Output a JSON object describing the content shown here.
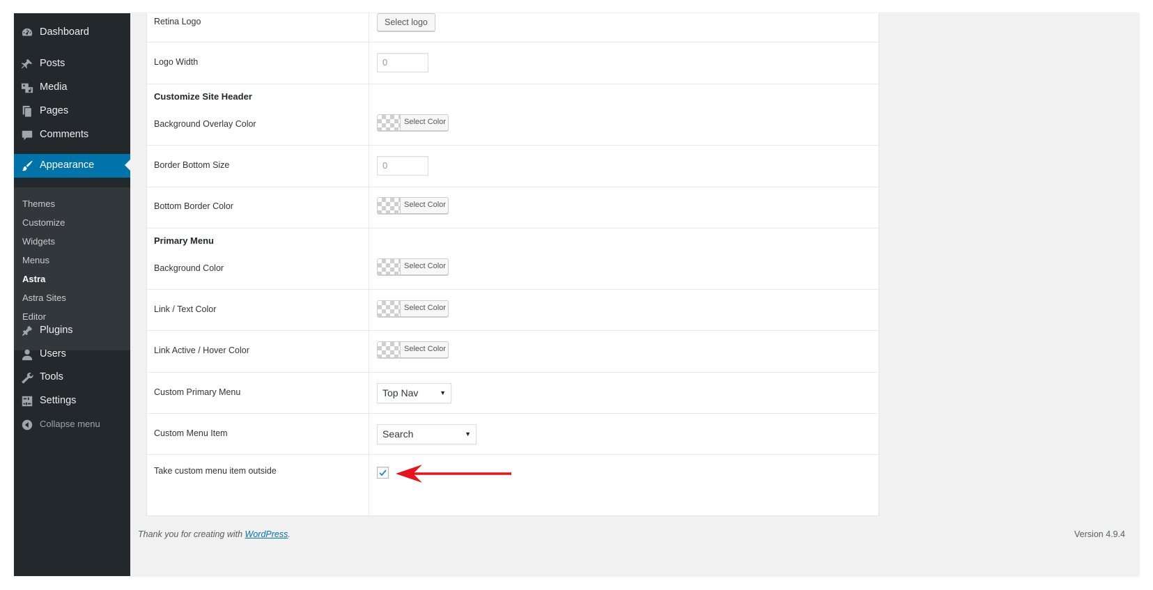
{
  "sidebar": {
    "items": [
      {
        "label": "Dashboard",
        "icon": "dashboard-icon"
      },
      {
        "label": "Posts",
        "icon": "pin-icon"
      },
      {
        "label": "Media",
        "icon": "media-icon"
      },
      {
        "label": "Pages",
        "icon": "pages-icon"
      },
      {
        "label": "Comments",
        "icon": "comment-icon"
      },
      {
        "label": "Appearance",
        "icon": "brush-icon"
      },
      {
        "label": "Plugins",
        "icon": "plugin-icon"
      },
      {
        "label": "Users",
        "icon": "user-icon"
      },
      {
        "label": "Tools",
        "icon": "wrench-icon"
      },
      {
        "label": "Settings",
        "icon": "settings-icon"
      }
    ],
    "submenu": [
      "Themes",
      "Customize",
      "Widgets",
      "Menus",
      "Astra",
      "Astra Sites",
      "Editor"
    ],
    "collapse_label": "Collapse menu",
    "current_item": "Appearance",
    "current_subitem": "Astra"
  },
  "form": {
    "retina_logo": {
      "label": "Retina Logo",
      "button": "Select logo"
    },
    "logo_width": {
      "label": "Logo Width",
      "value": "0"
    },
    "site_header": {
      "title": "Customize Site Header",
      "bg_overlay_label": "Background Overlay Color",
      "border_bottom_size_label": "Border Bottom Size",
      "border_bottom_size_value": "0",
      "bottom_border_color_label": "Bottom Border Color"
    },
    "primary_menu": {
      "title": "Primary Menu",
      "bg_color_label": "Background Color",
      "link_text_label": "Link / Text Color",
      "link_active_label": "Link Active / Hover Color",
      "custom_menu_label": "Custom Primary Menu",
      "custom_menu_value": "Top Nav",
      "custom_item_label": "Custom Menu Item",
      "custom_item_value": "Search",
      "outside_label": "Take custom menu item outside",
      "outside_checked": true
    },
    "select_color_label": "Select Color"
  },
  "footer": {
    "thanks_prefix": "Thank you for creating with ",
    "thanks_link": "WordPress",
    "thanks_suffix": ".",
    "version": "Version 4.9.4"
  },
  "colors": {
    "sidebar_bg": "#23282d",
    "submenu_bg": "#32373c",
    "accent": "#0073aa",
    "annotation_arrow": "#e8141c"
  }
}
